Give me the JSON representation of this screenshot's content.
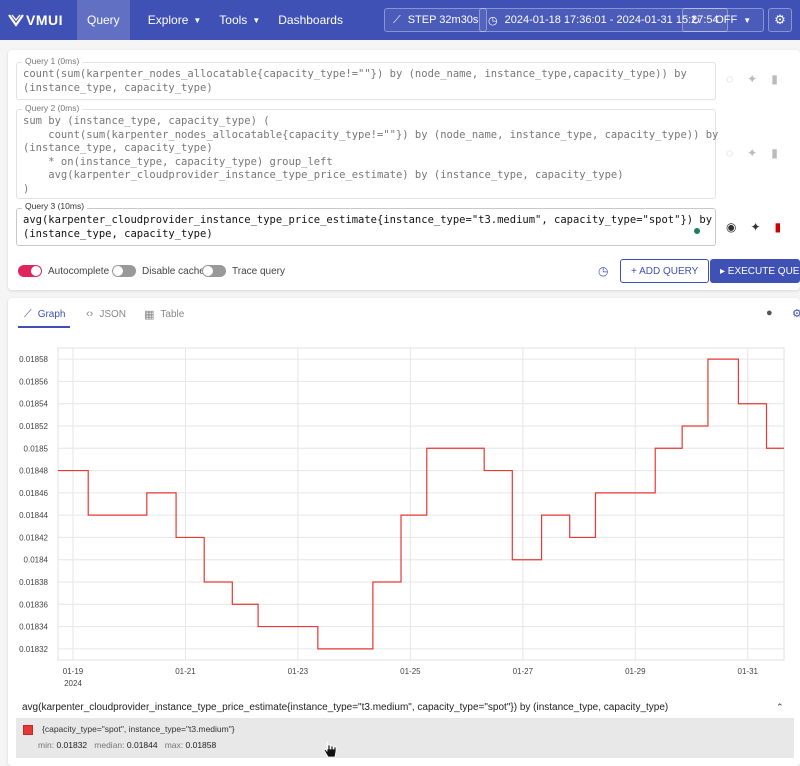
{
  "app": {
    "logo_text": "VMUI"
  },
  "nav": [
    {
      "label": "Query",
      "has_menu": false
    },
    {
      "label": "Explore",
      "has_menu": true
    },
    {
      "label": "Tools",
      "has_menu": true
    },
    {
      "label": "Dashboards",
      "has_menu": false
    }
  ],
  "toolbar": {
    "step_label": "STEP 32m30s",
    "time_range": "2024-01-18 17:36:01 - 2024-01-31 15:27:54",
    "refresh_label": "OFF"
  },
  "queries": [
    {
      "label": "Query 1 (0ms)",
      "text": "count(sum(karpenter_nodes_allocatable{capacity_type!=\"\"}) by (node_name, instance_type,capacity_type)) by\n(instance_type, capacity_type)"
    },
    {
      "label": "Query 2 (0ms)",
      "text": "sum by (instance_type, capacity_type) (\n    count(sum(karpenter_nodes_allocatable{capacity_type!=\"\"}) by (node_name, instance_type, capacity_type)) by\n(instance_type, capacity_type)\n    * on(instance_type, capacity_type) group_left\n    avg(karpenter_cloudprovider_instance_type_price_estimate) by (instance_type, capacity_type)\n)"
    },
    {
      "label": "Query 3 (10ms)",
      "text": "avg(karpenter_cloudprovider_instance_type_price_estimate{instance_type=\"t3.medium\", capacity_type=\"spot\"}) by\n(instance_type, capacity_type)"
    }
  ],
  "options": {
    "autocomplete": "Autocomplete",
    "disable_cache": "Disable cache",
    "trace_query": "Trace query"
  },
  "actions": {
    "add_query": "+ ADD QUERY",
    "execute_query": "▸ EXECUTE QUERY"
  },
  "tabs": [
    {
      "label": "Graph",
      "icon": "graph-icon"
    },
    {
      "label": "JSON",
      "icon": "code-icon"
    },
    {
      "label": "Table",
      "icon": "table-icon"
    }
  ],
  "chart_data": {
    "type": "line",
    "step": true,
    "grid": true,
    "color": "#e53935",
    "ylim": [
      0.01831,
      0.01859
    ],
    "y_ticks": [
      "0.01832",
      "0.01834",
      "0.01836",
      "0.01838",
      "0.0184",
      "0.01842",
      "0.01844",
      "0.01846",
      "0.01848",
      "0.0185",
      "0.01852",
      "0.01854",
      "0.01856",
      "0.01858"
    ],
    "x_ticks": [
      "01-19",
      "01-21",
      "01-23",
      "01-25",
      "01-27",
      "01-29",
      "01-31"
    ],
    "x_year": "2024",
    "x_range": [
      "2024-01-18 17:36:01",
      "2024-01-31 15:27:54"
    ],
    "series": [
      {
        "name": "{capacity_type=\"spot\", instance_type=\"t3.medium\"}",
        "points": [
          [
            "2024-01-18 17:36",
            0.01848
          ],
          [
            "2024-01-19 06:30",
            0.01844
          ],
          [
            "2024-01-20 07:30",
            0.01846
          ],
          [
            "2024-01-20 20:00",
            0.01842
          ],
          [
            "2024-01-21 08:00",
            0.01838
          ],
          [
            "2024-01-21 20:00",
            0.01836
          ],
          [
            "2024-01-22 07:00",
            0.01834
          ],
          [
            "2024-01-23 08:30",
            0.01832
          ],
          [
            "2024-01-24 08:00",
            0.01838
          ],
          [
            "2024-01-24 20:00",
            0.01844
          ],
          [
            "2024-01-25 07:00",
            0.0185
          ],
          [
            "2024-01-26 07:30",
            0.01848
          ],
          [
            "2024-01-26 19:30",
            0.0184
          ],
          [
            "2024-01-27 08:00",
            0.01844
          ],
          [
            "2024-01-27 20:00",
            0.01842
          ],
          [
            "2024-01-28 07:00",
            0.01846
          ],
          [
            "2024-01-29 08:30",
            0.0185
          ],
          [
            "2024-01-29 20:00",
            0.01852
          ],
          [
            "2024-01-30 07:00",
            0.01858
          ],
          [
            "2024-01-30 20:00",
            0.01854
          ],
          [
            "2024-01-31 08:00",
            0.0185
          ],
          [
            "2024-01-31 15:27",
            0.0185
          ]
        ]
      }
    ]
  },
  "legend": {
    "query_title": "avg(karpenter_cloudprovider_instance_type_price_estimate{instance_type=\"t3.medium\", capacity_type=\"spot\"}) by (instance_type, capacity_type)",
    "series_label": "{capacity_type=\"spot\", instance_type=\"t3.medium\"}",
    "min_label": "min:",
    "min": "0.01832",
    "median_label": "median:",
    "median": "0.01844",
    "max_label": "max:",
    "max": "0.01858"
  }
}
